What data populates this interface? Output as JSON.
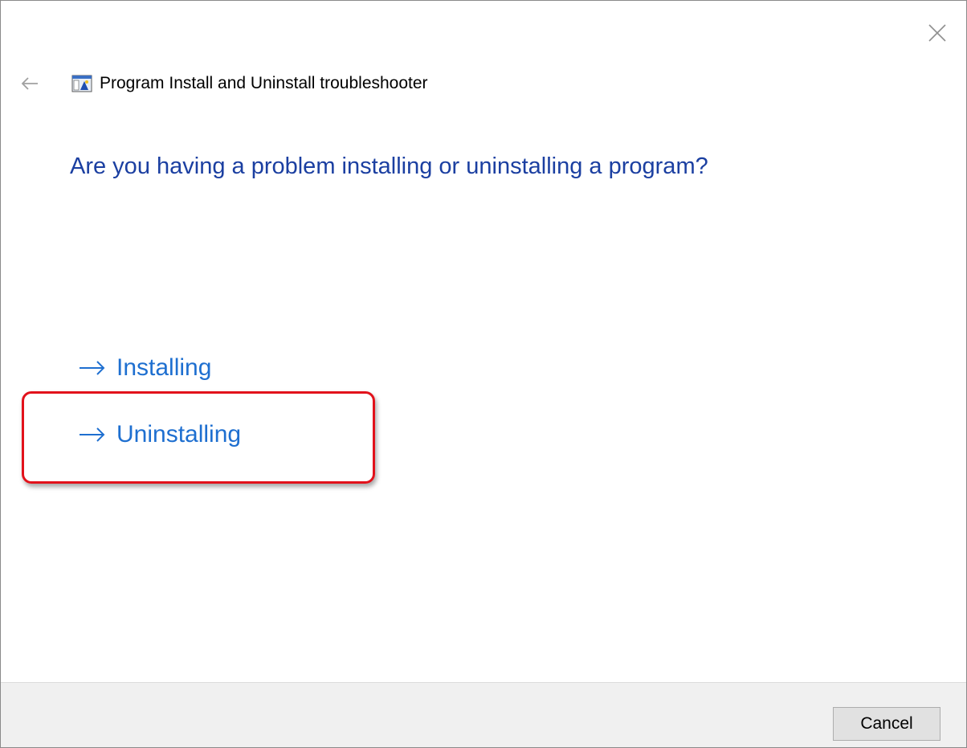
{
  "window": {
    "title": "Program Install and Uninstall troubleshooter",
    "close_icon": "close-icon",
    "back_icon": "back-arrow-icon",
    "app_icon": "troubleshooter-app-icon"
  },
  "main": {
    "question": "Are you having a problem installing or uninstalling a program?",
    "options": [
      {
        "label": "Installing",
        "icon": "right-arrow-icon",
        "highlighted": false
      },
      {
        "label": "Uninstalling",
        "icon": "right-arrow-icon",
        "highlighted": true
      }
    ]
  },
  "footer": {
    "cancel_label": "Cancel"
  },
  "colors": {
    "question_text": "#1b3fa1",
    "option_link": "#1e6fd0",
    "highlight_border": "#e2121b",
    "footer_bg": "#f0f0f0"
  }
}
